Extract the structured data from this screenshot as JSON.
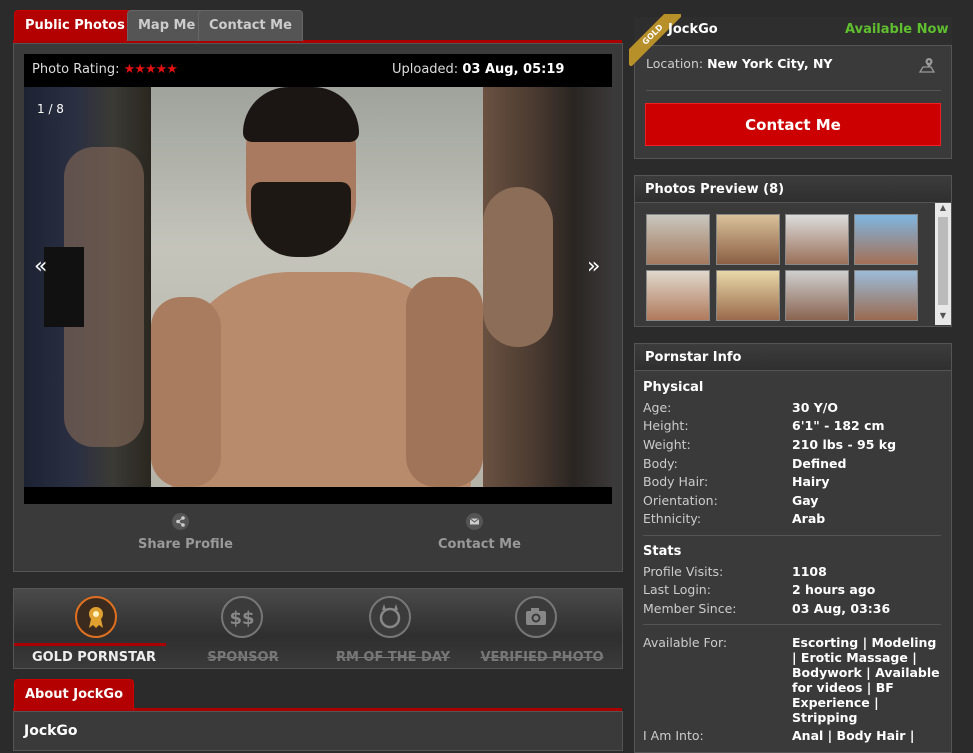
{
  "tabs": {
    "public_photos": "Public Photos",
    "map_me": "Map Me",
    "contact_me": "Contact Me"
  },
  "viewer": {
    "rating_label": "Photo Rating:",
    "rating_stars": "★★★★★",
    "uploaded_label": "Uploaded:",
    "uploaded_value": "03 Aug, 05:19",
    "counter": "1 / 8",
    "prev": "«",
    "next": "»"
  },
  "actions": {
    "share": "Share Profile",
    "contact": "Contact Me"
  },
  "badges": [
    {
      "label": "GOLD PORNSTAR",
      "icon": "medal-icon"
    },
    {
      "label": "SPONSOR",
      "icon": "dollar-icon"
    },
    {
      "label": "RM OF THE DAY",
      "icon": "devil-icon"
    },
    {
      "label": "VERIFIED PHOTO",
      "icon": "camera-icon"
    }
  ],
  "about": {
    "tab": "About JockGo",
    "name": "JockGo"
  },
  "profile": {
    "ribbon": "GOLD",
    "name": "JockGo",
    "status": "Available Now",
    "location_label": "Location:",
    "location_value": "New York City, NY",
    "contact_button": "Contact Me"
  },
  "photos_preview": {
    "title": "Photos Preview (8)"
  },
  "info": {
    "title": "Pornstar Info",
    "physical_title": "Physical",
    "physical": [
      {
        "label": "Age:",
        "value": "30 Y/O"
      },
      {
        "label": "Height:",
        "value": "6'1\" - 182 cm"
      },
      {
        "label": "Weight:",
        "value": "210 lbs - 95 kg"
      },
      {
        "label": "Body:",
        "value": "Defined"
      },
      {
        "label": "Body Hair:",
        "value": "Hairy"
      },
      {
        "label": "Orientation:",
        "value": "Gay"
      },
      {
        "label": "Ethnicity:",
        "value": "Arab"
      }
    ],
    "stats_title": "Stats",
    "stats": [
      {
        "label": "Profile Visits:",
        "value": "1108"
      },
      {
        "label": "Last Login:",
        "value": "2 hours ago"
      },
      {
        "label": "Member Since:",
        "value": "03 Aug, 03:36"
      }
    ],
    "available_label": "Available For:",
    "available_lines": [
      "Escorting | Modeling",
      "| Erotic Massage |",
      "Bodywork | Available",
      "for videos | BF",
      "Experience |",
      "Stripping"
    ],
    "into_label": "I Am Into:",
    "into_value": "Anal | Body Hair |"
  },
  "colors": {
    "accent": "#b30000",
    "available": "#5fbf2f",
    "star": "#e01010"
  }
}
